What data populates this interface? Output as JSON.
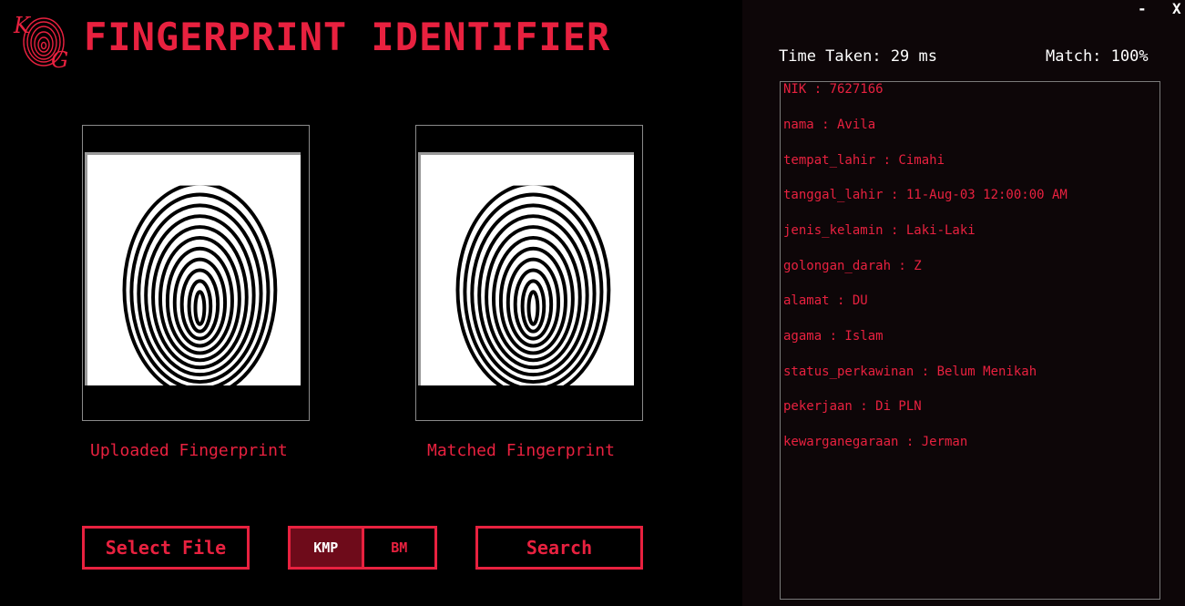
{
  "app": {
    "title": "FINGERPRINT IDENTIFIER",
    "logo_letters": [
      "K",
      "G"
    ]
  },
  "window": {
    "minimize": "-",
    "close": "X"
  },
  "images": {
    "uploaded_caption": "Uploaded Fingerprint",
    "matched_caption": "Matched Fingerprint"
  },
  "buttons": {
    "select_file": "Select File",
    "search": "Search"
  },
  "algorithm": {
    "options": [
      "KMP",
      "BM"
    ],
    "selected": "KMP"
  },
  "result": {
    "time_taken": "Time Taken: 29 ms",
    "match": "Match: 100%",
    "biodata": [
      "NIK : 7627166",
      "nama : Avila",
      "tempat_lahir : Cimahi",
      "tanggal_lahir : 11-Aug-03 12:00:00 AM",
      "jenis_kelamin : Laki-Laki",
      "golongan_darah : Z",
      "alamat : DU",
      "agama : Islam",
      "status_perkawinan : Belum Menikah",
      "pekerjaan : Di PLN",
      "kewarganegaraan : Jerman"
    ]
  },
  "colors": {
    "accent": "#e8213f",
    "accent_dark": "#6e0b1a",
    "panel_bg": "#0d0608",
    "bg": "#000000"
  }
}
